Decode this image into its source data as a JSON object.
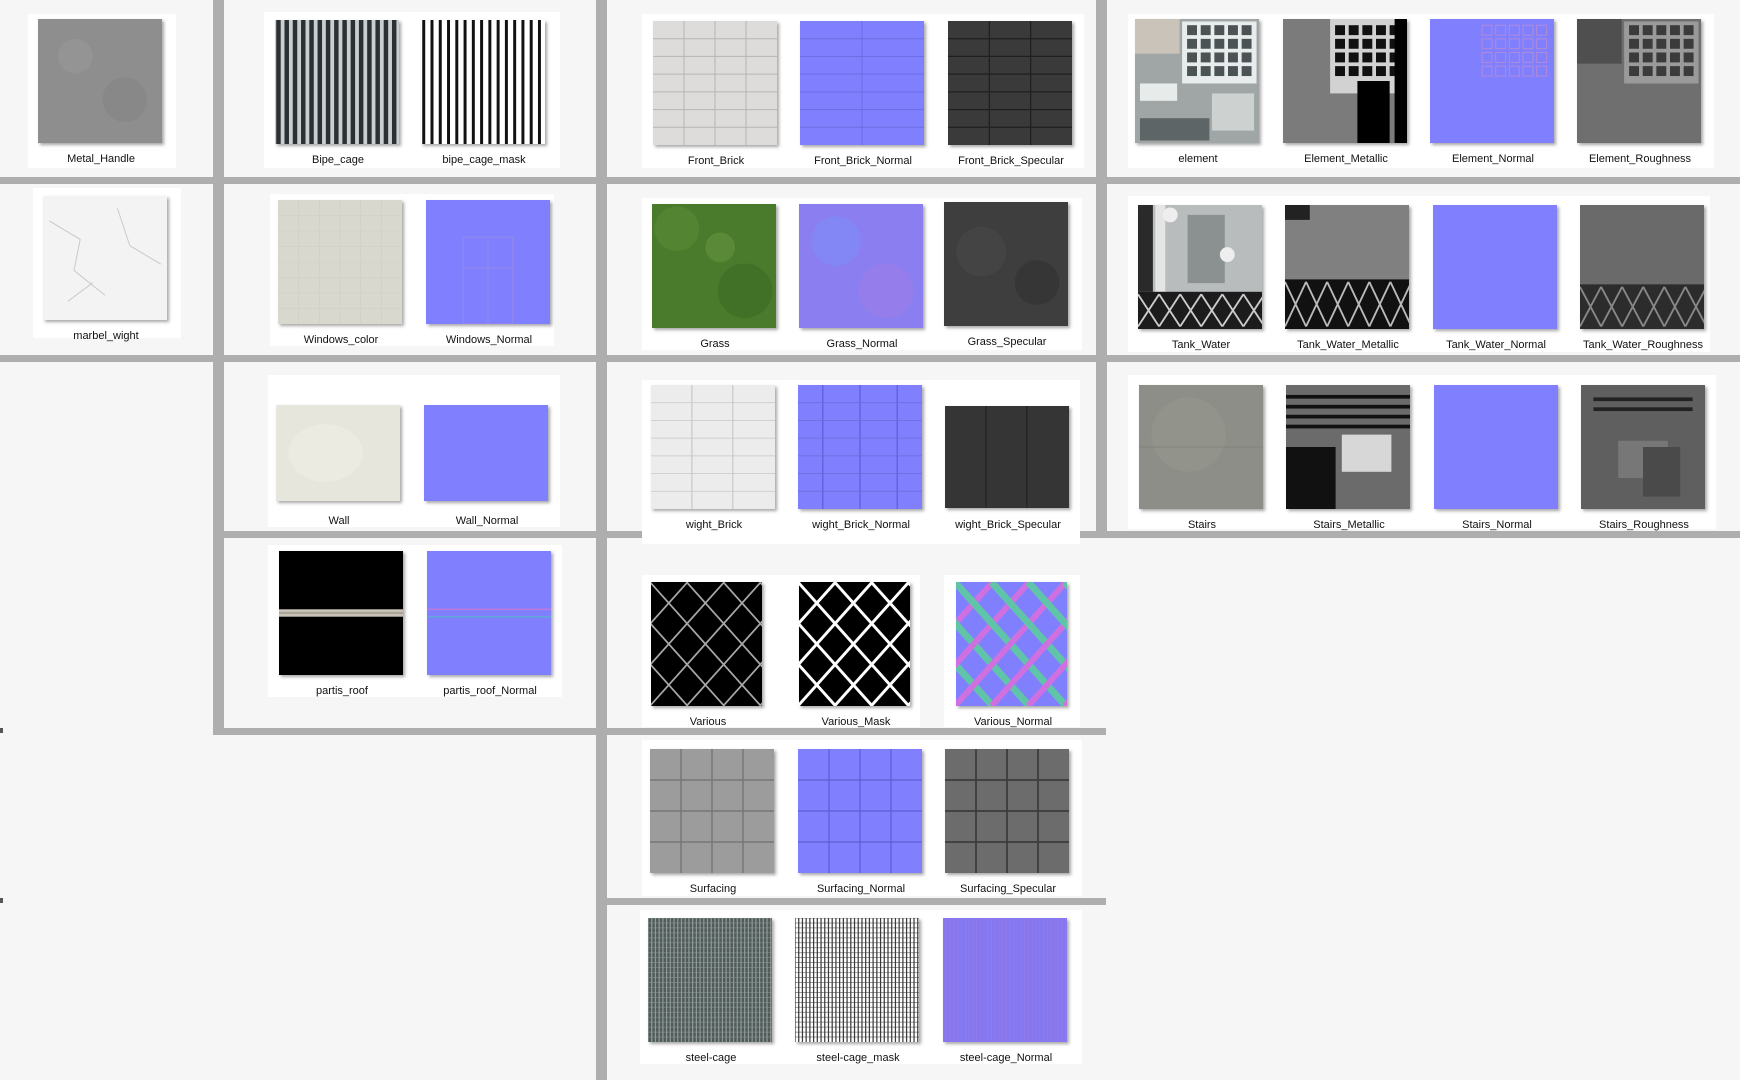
{
  "gallery": {
    "tiles": [
      {
        "label": "Metal_Handle",
        "texture": "concrete-gray"
      },
      {
        "label": "Bipe_cage",
        "texture": "stripes-dark"
      },
      {
        "label": "bipe_cage_mask",
        "texture": "stripes-bw"
      },
      {
        "label": "Front_Brick",
        "texture": "brick-light"
      },
      {
        "label": "Front_Brick_Normal",
        "texture": "normal-brick"
      },
      {
        "label": "Front_Brick_Specular",
        "texture": "brick-dark"
      },
      {
        "label": "element",
        "texture": "atlas-color"
      },
      {
        "label": "Element_Metallic",
        "texture": "atlas-metallic"
      },
      {
        "label": "Element_Normal",
        "texture": "atlas-normal"
      },
      {
        "label": "Element_Roughness",
        "texture": "atlas-roughness"
      },
      {
        "label": "marbel_wight",
        "texture": "marble-white"
      },
      {
        "label": "Windows_color",
        "texture": "windows-color"
      },
      {
        "label": "Windows_Normal",
        "texture": "normal-windows"
      },
      {
        "label": "Grass",
        "texture": "grass"
      },
      {
        "label": "Grass_Normal",
        "texture": "normal-grass"
      },
      {
        "label": "Grass_Specular",
        "texture": "grass-specular"
      },
      {
        "label": "Tank_Water",
        "texture": "tank-color"
      },
      {
        "label": "Tank_Water_Metallic",
        "texture": "tank-metallic"
      },
      {
        "label": "Tank_Water_Normal",
        "texture": "normal-flat"
      },
      {
        "label": "Tank_Water_Roughness",
        "texture": "tank-roughness"
      },
      {
        "label": "Wall",
        "texture": "wall-plaster"
      },
      {
        "label": "Wall_Normal",
        "texture": "normal-flat"
      },
      {
        "label": "wight_Brick",
        "texture": "brick-white"
      },
      {
        "label": "wight_Brick_Normal",
        "texture": "normal-brick-vertical"
      },
      {
        "label": "wight_Brick_Specular",
        "texture": "brick-dark-vertical"
      },
      {
        "label": "Stairs",
        "texture": "stairs-color"
      },
      {
        "label": "Stairs_Metallic",
        "texture": "stairs-metallic"
      },
      {
        "label": "Stairs_Normal",
        "texture": "normal-flat"
      },
      {
        "label": "Stairs_Roughness",
        "texture": "stairs-roughness"
      },
      {
        "label": "partis_roof",
        "texture": "roof-black"
      },
      {
        "label": "partis_roof_Normal",
        "texture": "normal-roof"
      },
      {
        "label": "Various",
        "texture": "fence-black"
      },
      {
        "label": "Various_Mask",
        "texture": "fence-mask"
      },
      {
        "label": "Various_Normal",
        "texture": "fence-normal"
      },
      {
        "label": "Surfacing",
        "texture": "tiles-gray"
      },
      {
        "label": "Surfacing_Normal",
        "texture": "normal-tiles"
      },
      {
        "label": "Surfacing_Specular",
        "texture": "tiles-dark"
      },
      {
        "label": "steel-cage",
        "texture": "mesh-dark"
      },
      {
        "label": "steel-cage_mask",
        "texture": "mesh-white"
      },
      {
        "label": "steel-cage_Normal",
        "texture": "normal-mesh"
      }
    ]
  }
}
